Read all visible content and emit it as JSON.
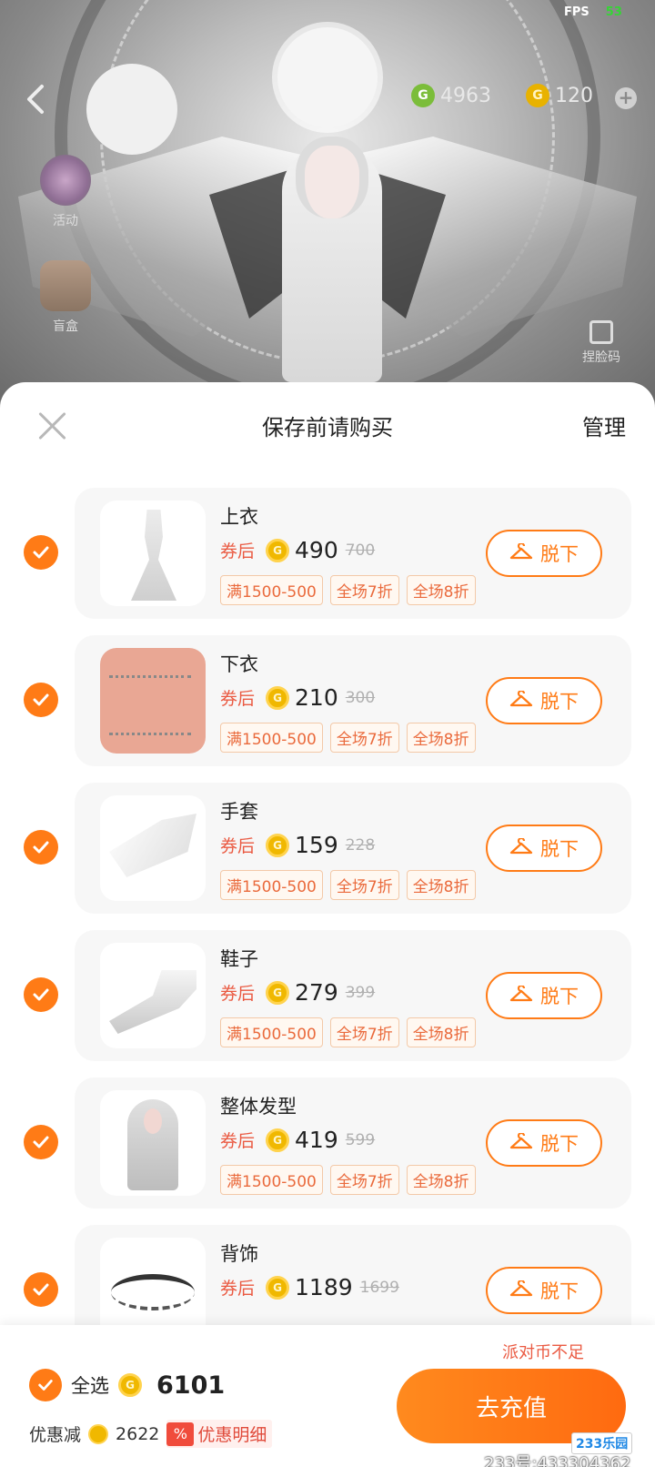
{
  "status": {
    "fps_label": "FPS",
    "fps_value": "53"
  },
  "top_bar": {
    "back_icon": "back-chevron-icon",
    "g_coin_amount": "4963",
    "party_coin_amount": "120",
    "add_icon": "plus-icon"
  },
  "side": {
    "activity_label": "活动",
    "blindbox_label": "盲盒",
    "pinch_label": "捏脸码"
  },
  "sheet": {
    "title": "保存前请购买",
    "manage_label": "管理",
    "items": [
      {
        "name": "上衣",
        "after_label": "券后",
        "price": "490",
        "original_price": "700",
        "tags": [
          "满1500-500",
          "全场7折",
          "全场8折"
        ],
        "action_label": "脱下",
        "checked": true
      },
      {
        "name": "下衣",
        "after_label": "券后",
        "price": "210",
        "original_price": "300",
        "tags": [
          "满1500-500",
          "全场7折",
          "全场8折"
        ],
        "action_label": "脱下",
        "checked": true
      },
      {
        "name": "手套",
        "after_label": "券后",
        "price": "159",
        "original_price": "228",
        "tags": [
          "满1500-500",
          "全场7折",
          "全场8折"
        ],
        "action_label": "脱下",
        "checked": true
      },
      {
        "name": "鞋子",
        "after_label": "券后",
        "price": "279",
        "original_price": "399",
        "tags": [
          "满1500-500",
          "全场7折",
          "全场8折"
        ],
        "action_label": "脱下",
        "checked": true
      },
      {
        "name": "整体发型",
        "after_label": "券后",
        "price": "419",
        "original_price": "599",
        "tags": [
          "满1500-500",
          "全场7折",
          "全场8折"
        ],
        "action_label": "脱下",
        "checked": true
      },
      {
        "name": "背饰",
        "after_label": "券后",
        "price": "1189",
        "original_price": "1699",
        "tags": [],
        "action_label": "脱下",
        "checked": true
      }
    ]
  },
  "footer": {
    "insufficient_text": "派对币不足",
    "select_all_label": "全选",
    "total": "6101",
    "discount_label": "优惠减",
    "discount_amount": "2622",
    "detail_icon_text": "%",
    "detail_label": "优惠明细",
    "recharge_label": "去充值",
    "watermark_logo": "233乐园",
    "watermark_id": "233号:433304362"
  },
  "colors": {
    "accent": "#ff7b16",
    "discount_red": "#ea5a42",
    "coin_gold": "#f0b800",
    "coin_green": "#7bbd3a"
  }
}
